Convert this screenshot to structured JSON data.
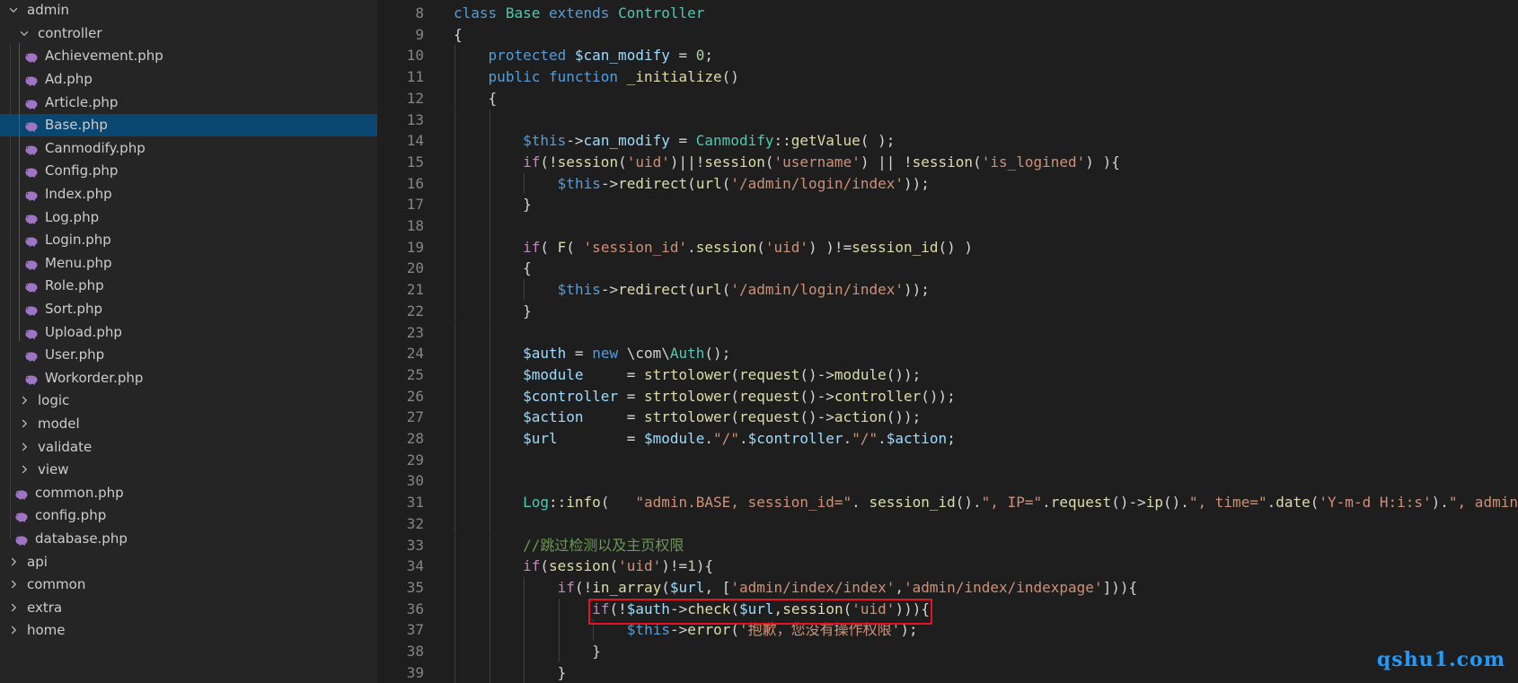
{
  "explorer": {
    "items": [
      {
        "label": "admin",
        "type": "folder",
        "expanded": true,
        "depth": 0,
        "selected": false
      },
      {
        "label": "controller",
        "type": "folder",
        "expanded": true,
        "depth": 1,
        "selected": false
      },
      {
        "label": "Achievement.php",
        "type": "file",
        "depth": 2,
        "selected": false
      },
      {
        "label": "Ad.php",
        "type": "file",
        "depth": 2,
        "selected": false
      },
      {
        "label": "Article.php",
        "type": "file",
        "depth": 2,
        "selected": false
      },
      {
        "label": "Base.php",
        "type": "file",
        "depth": 2,
        "selected": true
      },
      {
        "label": "Canmodify.php",
        "type": "file",
        "depth": 2,
        "selected": false
      },
      {
        "label": "Config.php",
        "type": "file",
        "depth": 2,
        "selected": false
      },
      {
        "label": "Index.php",
        "type": "file",
        "depth": 2,
        "selected": false
      },
      {
        "label": "Log.php",
        "type": "file",
        "depth": 2,
        "selected": false
      },
      {
        "label": "Login.php",
        "type": "file",
        "depth": 2,
        "selected": false
      },
      {
        "label": "Menu.php",
        "type": "file",
        "depth": 2,
        "selected": false
      },
      {
        "label": "Role.php",
        "type": "file",
        "depth": 2,
        "selected": false
      },
      {
        "label": "Sort.php",
        "type": "file",
        "depth": 2,
        "selected": false
      },
      {
        "label": "Upload.php",
        "type": "file",
        "depth": 2,
        "selected": false
      },
      {
        "label": "User.php",
        "type": "file",
        "depth": 2,
        "selected": false
      },
      {
        "label": "Workorder.php",
        "type": "file",
        "depth": 2,
        "selected": false
      },
      {
        "label": "logic",
        "type": "folder",
        "expanded": false,
        "depth": 1,
        "selected": false
      },
      {
        "label": "model",
        "type": "folder",
        "expanded": false,
        "depth": 1,
        "selected": false
      },
      {
        "label": "validate",
        "type": "folder",
        "expanded": false,
        "depth": 1,
        "selected": false
      },
      {
        "label": "view",
        "type": "folder",
        "expanded": false,
        "depth": 1,
        "selected": false
      },
      {
        "label": "common.php",
        "type": "file",
        "depth": 1,
        "selected": false
      },
      {
        "label": "config.php",
        "type": "file",
        "depth": 1,
        "selected": false
      },
      {
        "label": "database.php",
        "type": "file",
        "depth": 1,
        "selected": false
      },
      {
        "label": "api",
        "type": "folder",
        "expanded": false,
        "depth": 0,
        "selected": false
      },
      {
        "label": "common",
        "type": "folder",
        "expanded": false,
        "depth": 0,
        "selected": false
      },
      {
        "label": "extra",
        "type": "folder",
        "expanded": false,
        "depth": 0,
        "selected": false
      },
      {
        "label": "home",
        "type": "folder",
        "expanded": false,
        "depth": 0,
        "selected": false
      }
    ]
  },
  "editor": {
    "lines": [
      {
        "num": "8",
        "indent": 0,
        "tokens": [
          [
            "class",
            "k"
          ],
          [
            " ",
            "p"
          ],
          [
            "Base",
            "cls"
          ],
          [
            " ",
            "p"
          ],
          [
            "extends",
            "k"
          ],
          [
            " ",
            "p"
          ],
          [
            "Controller",
            "cls"
          ]
        ]
      },
      {
        "num": "9",
        "indent": 0,
        "tokens": [
          [
            "{",
            "p"
          ]
        ]
      },
      {
        "num": "10",
        "indent": 1,
        "tokens": [
          [
            "protected",
            "k"
          ],
          [
            " ",
            "p"
          ],
          [
            "$can_modify",
            "v"
          ],
          [
            " = ",
            "p"
          ],
          [
            "0",
            "n"
          ],
          [
            ";",
            "p"
          ]
        ]
      },
      {
        "num": "11",
        "indent": 1,
        "tokens": [
          [
            "public",
            "k"
          ],
          [
            " ",
            "p"
          ],
          [
            "function",
            "k"
          ],
          [
            " ",
            "p"
          ],
          [
            "_initialize",
            "f"
          ],
          [
            "()",
            "p"
          ]
        ]
      },
      {
        "num": "12",
        "indent": 1,
        "tokens": [
          [
            "{",
            "p"
          ]
        ]
      },
      {
        "num": "13",
        "indent": 2,
        "tokens": []
      },
      {
        "num": "14",
        "indent": 2,
        "tokens": [
          [
            "$this",
            "this"
          ],
          [
            "->",
            "p"
          ],
          [
            "can_modify",
            "v"
          ],
          [
            " = ",
            "p"
          ],
          [
            "Canmodify",
            "cls"
          ],
          [
            "::",
            "p"
          ],
          [
            "getValue",
            "f"
          ],
          [
            "( );",
            "p"
          ]
        ]
      },
      {
        "num": "15",
        "indent": 2,
        "tokens": [
          [
            "if",
            "c"
          ],
          [
            "(!",
            "p"
          ],
          [
            "session",
            "f"
          ],
          [
            "(",
            "p"
          ],
          [
            "'uid'",
            "s"
          ],
          [
            ")||!",
            "p"
          ],
          [
            "session",
            "f"
          ],
          [
            "(",
            "p"
          ],
          [
            "'username'",
            "s"
          ],
          [
            ") || !",
            "p"
          ],
          [
            "session",
            "f"
          ],
          [
            "(",
            "p"
          ],
          [
            "'is_logined'",
            "s"
          ],
          [
            ") ){",
            "p"
          ]
        ]
      },
      {
        "num": "16",
        "indent": 3,
        "tokens": [
          [
            "$this",
            "this"
          ],
          [
            "->",
            "p"
          ],
          [
            "redirect",
            "f"
          ],
          [
            "(",
            "p"
          ],
          [
            "url",
            "f"
          ],
          [
            "(",
            "p"
          ],
          [
            "'/admin/login/index'",
            "s"
          ],
          [
            "));",
            "p"
          ]
        ]
      },
      {
        "num": "17",
        "indent": 2,
        "tokens": [
          [
            "}",
            "p"
          ]
        ]
      },
      {
        "num": "18",
        "indent": 2,
        "tokens": []
      },
      {
        "num": "19",
        "indent": 2,
        "tokens": [
          [
            "if",
            "c"
          ],
          [
            "( ",
            "p"
          ],
          [
            "F",
            "f"
          ],
          [
            "( ",
            "p"
          ],
          [
            "'session_id'",
            "s"
          ],
          [
            ".",
            "p"
          ],
          [
            "session",
            "f"
          ],
          [
            "(",
            "p"
          ],
          [
            "'uid'",
            "s"
          ],
          [
            ") )!=",
            "p"
          ],
          [
            "session_id",
            "f"
          ],
          [
            "() )",
            "p"
          ]
        ]
      },
      {
        "num": "20",
        "indent": 2,
        "tokens": [
          [
            "{",
            "p"
          ]
        ]
      },
      {
        "num": "21",
        "indent": 3,
        "tokens": [
          [
            "$this",
            "this"
          ],
          [
            "->",
            "p"
          ],
          [
            "redirect",
            "f"
          ],
          [
            "(",
            "p"
          ],
          [
            "url",
            "f"
          ],
          [
            "(",
            "p"
          ],
          [
            "'/admin/login/index'",
            "s"
          ],
          [
            "));",
            "p"
          ]
        ]
      },
      {
        "num": "22",
        "indent": 2,
        "tokens": [
          [
            "}",
            "p"
          ]
        ]
      },
      {
        "num": "23",
        "indent": 2,
        "tokens": []
      },
      {
        "num": "24",
        "indent": 2,
        "tokens": [
          [
            "$auth",
            "v"
          ],
          [
            " = ",
            "p"
          ],
          [
            "new",
            "k"
          ],
          [
            " \\com\\",
            "p"
          ],
          [
            "Auth",
            "cls"
          ],
          [
            "();",
            "p"
          ]
        ]
      },
      {
        "num": "25",
        "indent": 2,
        "tokens": [
          [
            "$module",
            "v"
          ],
          [
            "     = ",
            "p"
          ],
          [
            "strtolower",
            "f"
          ],
          [
            "(",
            "p"
          ],
          [
            "request",
            "f"
          ],
          [
            "()->",
            "p"
          ],
          [
            "module",
            "f"
          ],
          [
            "());",
            "p"
          ]
        ]
      },
      {
        "num": "26",
        "indent": 2,
        "tokens": [
          [
            "$controller",
            "v"
          ],
          [
            " = ",
            "p"
          ],
          [
            "strtolower",
            "f"
          ],
          [
            "(",
            "p"
          ],
          [
            "request",
            "f"
          ],
          [
            "()->",
            "p"
          ],
          [
            "controller",
            "f"
          ],
          [
            "());",
            "p"
          ]
        ]
      },
      {
        "num": "27",
        "indent": 2,
        "tokens": [
          [
            "$action",
            "v"
          ],
          [
            "     = ",
            "p"
          ],
          [
            "strtolower",
            "f"
          ],
          [
            "(",
            "p"
          ],
          [
            "request",
            "f"
          ],
          [
            "()->",
            "p"
          ],
          [
            "action",
            "f"
          ],
          [
            "());",
            "p"
          ]
        ]
      },
      {
        "num": "28",
        "indent": 2,
        "tokens": [
          [
            "$url",
            "v"
          ],
          [
            "        = ",
            "p"
          ],
          [
            "$module",
            "v"
          ],
          [
            ".",
            "p"
          ],
          [
            "\"/\"",
            "s"
          ],
          [
            ".",
            "p"
          ],
          [
            "$controller",
            "v"
          ],
          [
            ".",
            "p"
          ],
          [
            "\"/\"",
            "s"
          ],
          [
            ".",
            "p"
          ],
          [
            "$action",
            "v"
          ],
          [
            ";",
            "p"
          ]
        ]
      },
      {
        "num": "29",
        "indent": 2,
        "tokens": []
      },
      {
        "num": "30",
        "indent": 2,
        "tokens": []
      },
      {
        "num": "31",
        "indent": 2,
        "tokens": [
          [
            "Log",
            "cls"
          ],
          [
            "::",
            "p"
          ],
          [
            "info",
            "f"
          ],
          [
            "(   ",
            "p"
          ],
          [
            "\"admin.BASE, session_id=\"",
            "s"
          ],
          [
            ". ",
            "p"
          ],
          [
            "session_id",
            "f"
          ],
          [
            "().",
            "p"
          ],
          [
            "\", IP=\"",
            "s"
          ],
          [
            ".",
            "p"
          ],
          [
            "request",
            "f"
          ],
          [
            "()->",
            "p"
          ],
          [
            "ip",
            "f"
          ],
          [
            "().",
            "p"
          ],
          [
            "\", time=\"",
            "s"
          ],
          [
            ".",
            "p"
          ],
          [
            "date",
            "f"
          ],
          [
            "(",
            "p"
          ],
          [
            "'Y-m-d H:i:s'",
            "s"
          ],
          [
            ").",
            "p"
          ],
          [
            "\", admin",
            "s"
          ]
        ]
      },
      {
        "num": "32",
        "indent": 2,
        "tokens": []
      },
      {
        "num": "33",
        "indent": 2,
        "tokens": [
          [
            "//跳过检测以及主页权限",
            "cm"
          ]
        ]
      },
      {
        "num": "34",
        "indent": 2,
        "tokens": [
          [
            "if",
            "c"
          ],
          [
            "(",
            "p"
          ],
          [
            "session",
            "f"
          ],
          [
            "(",
            "p"
          ],
          [
            "'uid'",
            "s"
          ],
          [
            ")!=",
            "p"
          ],
          [
            "1",
            "n"
          ],
          [
            "){",
            "p"
          ]
        ]
      },
      {
        "num": "35",
        "indent": 3,
        "tokens": [
          [
            "if",
            "c"
          ],
          [
            "(!",
            "p"
          ],
          [
            "in_array",
            "f"
          ],
          [
            "(",
            "p"
          ],
          [
            "$url",
            "v"
          ],
          [
            ", [",
            "p"
          ],
          [
            "'admin/index/index'",
            "s"
          ],
          [
            ",",
            "p"
          ],
          [
            "'admin/index/indexpage'",
            "s"
          ],
          [
            "])){",
            "p"
          ]
        ]
      },
      {
        "num": "36",
        "indent": 4,
        "tokens": [
          [
            "if",
            "c"
          ],
          [
            "(!",
            "p"
          ],
          [
            "$auth",
            "v"
          ],
          [
            "->",
            "p"
          ],
          [
            "check",
            "f"
          ],
          [
            "(",
            "p"
          ],
          [
            "$url",
            "v"
          ],
          [
            ",",
            "p"
          ],
          [
            "session",
            "f"
          ],
          [
            "(",
            "p"
          ],
          [
            "'uid'",
            "s"
          ],
          [
            "))){",
            "p"
          ]
        ]
      },
      {
        "num": "37",
        "indent": 5,
        "tokens": [
          [
            "$this",
            "this"
          ],
          [
            "->",
            "p"
          ],
          [
            "error",
            "f"
          ],
          [
            "(",
            "p"
          ],
          [
            "'抱歉，您没有操作权限'",
            "s"
          ],
          [
            ");",
            "p"
          ]
        ]
      },
      {
        "num": "38",
        "indent": 4,
        "tokens": [
          [
            "}",
            "p"
          ]
        ]
      },
      {
        "num": "39",
        "indent": 3,
        "tokens": [
          [
            "}",
            "p"
          ]
        ]
      }
    ]
  },
  "watermark": "qshu1.com",
  "colors": {
    "editor_bg": "#1e1e1e",
    "sidebar_bg": "#252526",
    "selection": "#094771",
    "highlight_box": "#e81123",
    "watermark": "#1e9bff"
  }
}
